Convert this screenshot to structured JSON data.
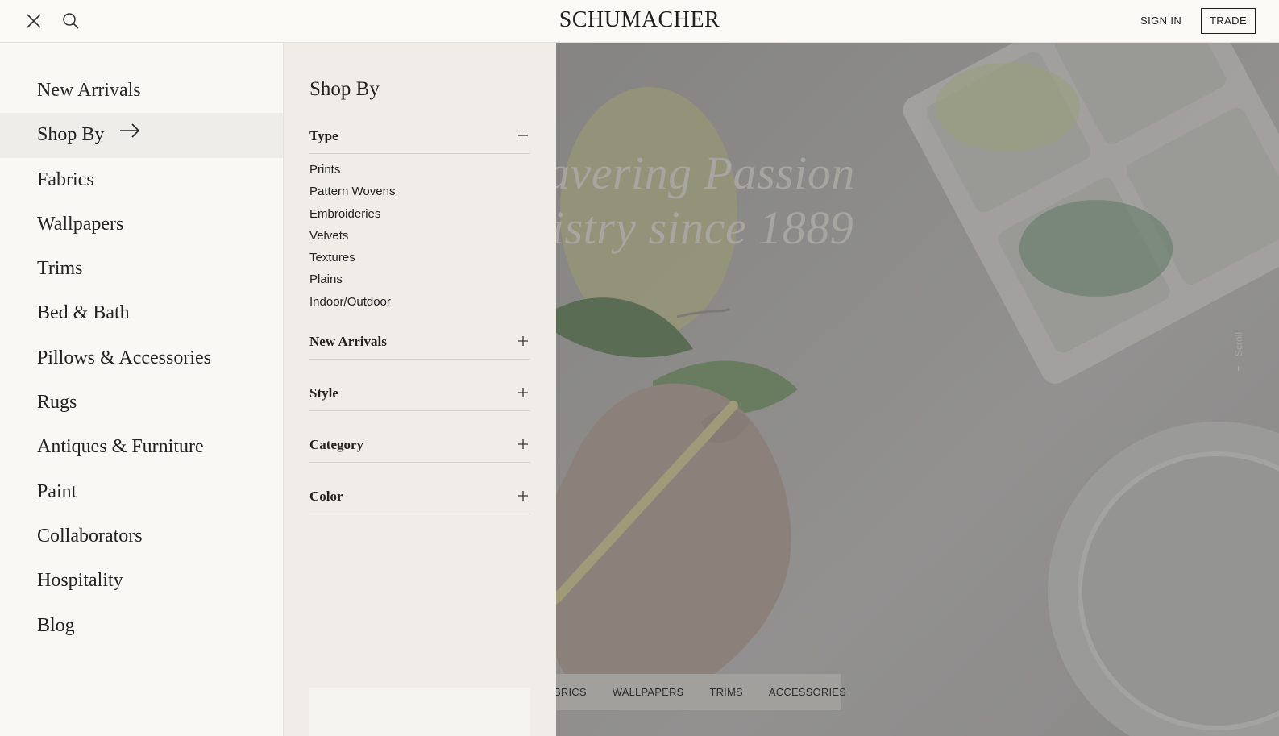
{
  "header": {
    "logo": "SCHUMACHER",
    "sign_in": "SIGN IN",
    "trade": "TRADE",
    "icons": [
      "close-icon",
      "search-icon"
    ]
  },
  "menu": {
    "items": [
      {
        "label": "New Arrivals"
      },
      {
        "label": "Shop By",
        "active": true
      },
      {
        "label": "Fabrics"
      },
      {
        "label": "Wallpapers"
      },
      {
        "label": "Trims"
      },
      {
        "label": "Bed & Bath"
      },
      {
        "label": "Pillows & Accessories"
      },
      {
        "label": "Rugs"
      },
      {
        "label": "Antiques & Furniture"
      },
      {
        "label": "Paint"
      },
      {
        "label": "Collaborators"
      },
      {
        "label": "Hospitality"
      },
      {
        "label": "Blog"
      }
    ]
  },
  "submenu": {
    "title": "Shop By",
    "sections": [
      {
        "label": "Type",
        "expanded": true,
        "items": [
          "Prints",
          "Pattern Wovens",
          "Embroideries",
          "Velvets",
          "Textures",
          "Plains",
          "Indoor/Outdoor"
        ]
      },
      {
        "label": "New Arrivals",
        "expanded": false
      },
      {
        "label": "Style",
        "expanded": false
      },
      {
        "label": "Category",
        "expanded": false
      },
      {
        "label": "Color",
        "expanded": false
      }
    ]
  },
  "hero": {
    "line1": "avering Passion",
    "line2": "istry since 1889",
    "scroll": "Scroll",
    "categories": [
      "BRICS",
      "WALLPAPERS",
      "TRIMS",
      "ACCESSORIES"
    ]
  },
  "colors": {
    "panel_left": "#f9f8f5",
    "panel_sub": "#f0ede9",
    "active_item": "#efedea",
    "overlay": "#8f8e8c",
    "text": "#222222"
  }
}
